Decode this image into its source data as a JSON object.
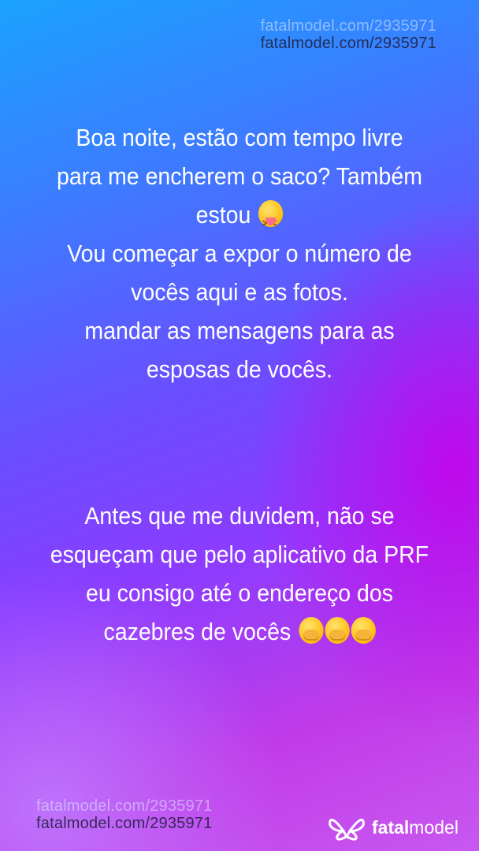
{
  "watermarks": {
    "top": [
      "fatalmodel.com/2935971",
      "fatalmodel.com/2935971"
    ],
    "bottom": [
      "fatalmodel.com/2935971",
      "fatalmodel.com/2935971"
    ]
  },
  "story": {
    "block1": [
      "Boa noite, estão com tempo livre",
      "para me encherem o saco? Também",
      "estou",
      "Vou começar a  expor o número de",
      "vocês aqui e as fotos.",
      "mandar as mensagens para as",
      "esposas de vocês."
    ],
    "block2": [
      "Antes que me duvidem, não se",
      "esqueçam que pelo aplicativo da PRF",
      "eu consigo até o endereço dos",
      "cazebres de vocês"
    ],
    "emojis": {
      "block1_line3": "squinting-tongue-face-icon",
      "block2_line4": [
        "hand-over-mouth-face-icon",
        "hand-over-mouth-face-icon",
        "hand-over-mouth-face-icon"
      ]
    }
  },
  "logo": {
    "bold": "fatal",
    "regular": "model"
  },
  "colors": {
    "text": "#ffffff",
    "gradient_start": "#1aa2ff",
    "gradient_end": "#c858f0"
  }
}
